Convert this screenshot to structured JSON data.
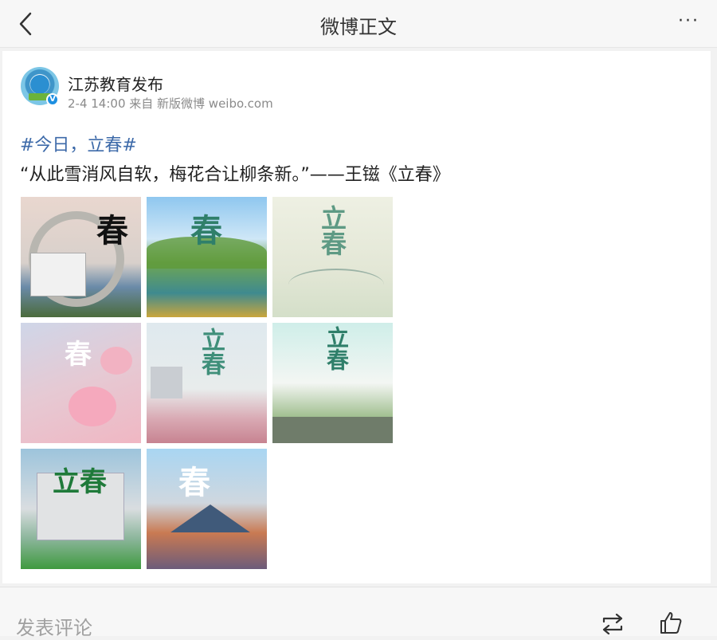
{
  "header": {
    "title": "微博正文",
    "back_icon": "chevron-left-icon",
    "more_icon": "more-dots-icon",
    "more_label": "···"
  },
  "post": {
    "author": "江苏教育发布",
    "meta": "2-4 14:00 来自 新版微博 weibo.com",
    "verified_badge": "V",
    "hashtag": "#今日，立春#",
    "text": "“从此雪消风自软，梅花合让柳条新。”——王镃《立春》",
    "images": [
      {
        "glyph": "春",
        "theme": "garden-bridge"
      },
      {
        "glyph": "春",
        "theme": "lake-trees"
      },
      {
        "glyph": "立春",
        "theme": "pale-swallows"
      },
      {
        "glyph": "春",
        "theme": "peach-blossom"
      },
      {
        "glyph": "立春",
        "theme": "misty-city"
      },
      {
        "glyph": "立春",
        "theme": "willow-swallow"
      },
      {
        "glyph": "立春",
        "theme": "campus-building"
      },
      {
        "glyph": "春",
        "theme": "pavilion"
      }
    ]
  },
  "footer": {
    "comment_placeholder": "发表评论",
    "repost_icon": "repost-icon",
    "like_icon": "thumbs-up-icon"
  },
  "colors": {
    "link": "#3d6aa9",
    "verified": "#1d8fe1"
  }
}
